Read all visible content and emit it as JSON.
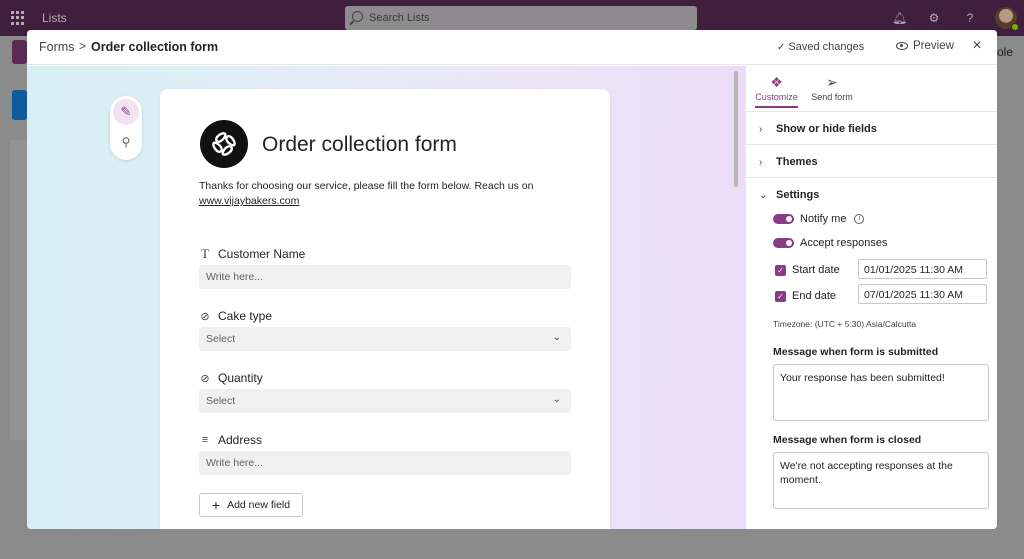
{
  "appbar": {
    "app_title": "Lists",
    "search_placeholder": "Search Lists"
  },
  "background": {
    "partial_text": "ole"
  },
  "modal": {
    "breadcrumb": {
      "root": "Forms",
      "separator": ">",
      "current": "Order collection form"
    },
    "saved_status": "Saved changes",
    "preview_label": "Preview",
    "close_glyph": "×"
  },
  "form": {
    "title": "Order collection form",
    "description": "Thanks for choosing our service, please fill the form below. Reach us on",
    "link": "www.vijaybakers.com",
    "fields": [
      {
        "label": "Customer Name",
        "icon": "text-icon",
        "type": "text",
        "placeholder": "Write here..."
      },
      {
        "label": "Cake type",
        "icon": "choice-icon",
        "type": "select",
        "placeholder": "Select"
      },
      {
        "label": "Quantity",
        "icon": "choice-icon",
        "type": "select",
        "placeholder": "Select"
      },
      {
        "label": "Address",
        "icon": "multiline-icon",
        "type": "text",
        "placeholder": "Write here..."
      }
    ],
    "add_field_label": "Add new field"
  },
  "panel": {
    "tabs": [
      {
        "label": "Customize",
        "icon": "customize-icon",
        "active": true
      },
      {
        "label": "Send form",
        "icon": "send-icon",
        "active": false
      }
    ],
    "sections": {
      "show_hide": "Show or hide fields",
      "themes": "Themes",
      "settings": "Settings"
    },
    "settings": {
      "notify_me": "Notify me",
      "accept_responses": "Accept responses",
      "start_date_label": "Start date",
      "start_date_value": "01/01/2025 11:30 AM",
      "end_date_label": "End date",
      "end_date_value": "07/01/2025 11:30 AM",
      "timezone": "Timezone: (UTC + 5:30) Asia/Calcutta",
      "submitted_label": "Message when form is submitted",
      "submitted_message": "Your response has been submitted!",
      "closed_label": "Message when form is closed",
      "closed_message": "We're not accepting responses at the moment."
    }
  },
  "colors": {
    "accent": "#8b3b86",
    "appbar": "#3f1f3d"
  }
}
